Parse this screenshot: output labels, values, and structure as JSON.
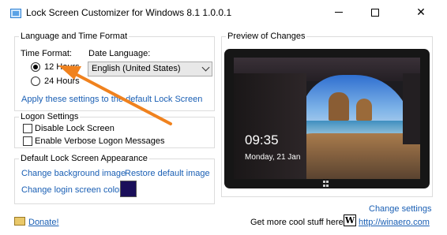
{
  "window": {
    "title": "Lock Screen Customizer for Windows 8.1 1.0.0.1",
    "minimize_glyph": "—",
    "maximize_glyph": "☐",
    "close_glyph": "✕"
  },
  "lang_time": {
    "group_title": "Language and Time Format",
    "time_format_label": "Time Format:",
    "radio_12": "12 Hours",
    "radio_24": "24 Hours",
    "selected_format": "12 Hours",
    "date_language_label": "Date Language:",
    "date_language_value": "English (United States)",
    "apply_link": "Apply these settings to the default Lock Screen"
  },
  "logon": {
    "group_title": "Logon Settings",
    "disable_lock": "Disable Lock Screen",
    "disable_lock_checked": false,
    "verbose": "Enable Verbose Logon Messages",
    "verbose_checked": false
  },
  "appearance": {
    "group_title": "Default Lock Screen Appearance",
    "change_bg": "Change background image",
    "restore_default": "Restore default image",
    "change_login_color": "Change login screen color",
    "login_color": "#1a0f5a"
  },
  "preview": {
    "group_title": "Preview of Changes",
    "time": "09:35",
    "date": "Monday, 21 Jan"
  },
  "footer": {
    "change_settings": "Change settings",
    "donate": "Donate!",
    "more_stuff": "Get more cool stuff here:",
    "winaero_logo": "W",
    "winaero_link": "http://winaero.com"
  },
  "colors": {
    "link": "#1a5fb4",
    "arrow": "#f0821e"
  },
  "icons": {
    "app": "app-window-icon",
    "donate": "donate-icon",
    "winaero": "winaero-logo-icon"
  }
}
